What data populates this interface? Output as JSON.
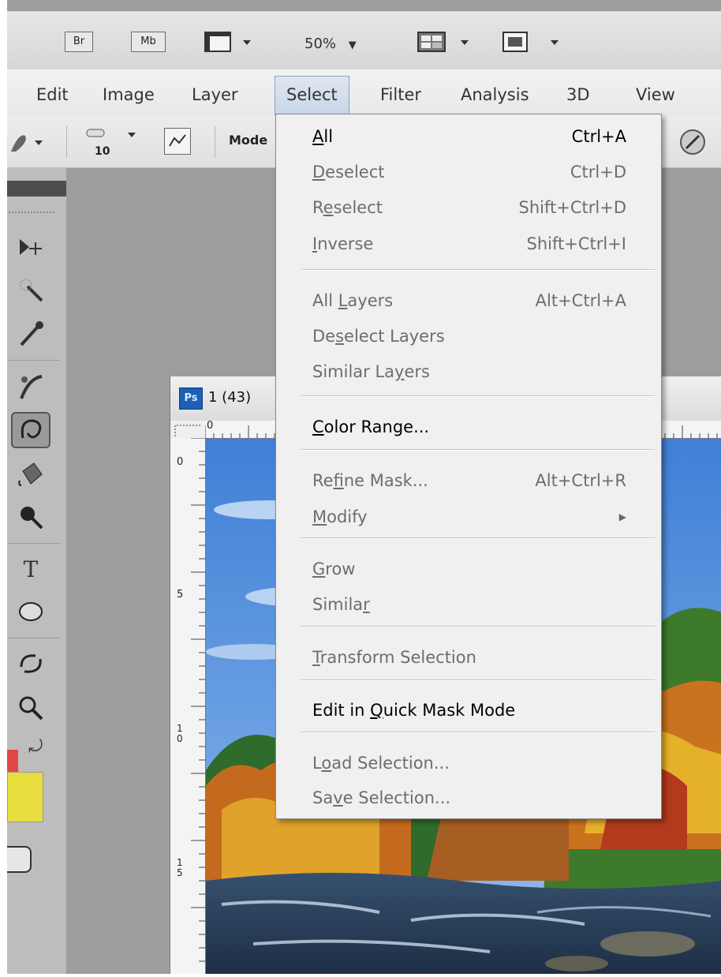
{
  "appbar": {
    "bridge_label": "Br",
    "minibridge_label": "Mb",
    "zoom_value": "50%",
    "dropdown_arrow": "▼"
  },
  "menubar": {
    "items": [
      "Edit",
      "Image",
      "Layer",
      "Select",
      "Filter",
      "Analysis",
      "3D",
      "View"
    ],
    "active": "Select"
  },
  "options": {
    "brush_size": "10",
    "mode_label": "Mode"
  },
  "document": {
    "tab_icon": "Ps",
    "title": "1 (43)",
    "ruler_top_zero": "0",
    "ruler_left_labels": [
      "0",
      "5",
      "1\n0",
      "1\n5"
    ]
  },
  "select_menu": {
    "items": [
      {
        "label": "All",
        "mnemonic": "A",
        "shortcut": "Ctrl+A",
        "enabled": true
      },
      {
        "label": "Deselect",
        "mnemonic": "D",
        "shortcut": "Ctrl+D",
        "enabled": false
      },
      {
        "label": "Reselect",
        "mnemonic": "e",
        "shortcut": "Shift+Ctrl+D",
        "enabled": false
      },
      {
        "label": "Inverse",
        "mnemonic": "I",
        "shortcut": "Shift+Ctrl+I",
        "enabled": false
      },
      {
        "label": "All Layers",
        "mnemonic": "L",
        "shortcut": "Alt+Ctrl+A",
        "enabled": false
      },
      {
        "label": "Deselect Layers",
        "mnemonic": "s",
        "shortcut": "",
        "enabled": false
      },
      {
        "label": "Similar Layers",
        "mnemonic": "y",
        "shortcut": "",
        "enabled": false
      },
      {
        "label": "Color Range...",
        "mnemonic": "C",
        "shortcut": "",
        "enabled": true
      },
      {
        "label": "Refine Mask...",
        "mnemonic": "f",
        "shortcut": "Alt+Ctrl+R",
        "enabled": false
      },
      {
        "label": "Modify",
        "mnemonic": "M",
        "shortcut": "",
        "enabled": false,
        "submenu": true
      },
      {
        "label": "Grow",
        "mnemonic": "G",
        "shortcut": "",
        "enabled": false
      },
      {
        "label": "Similar",
        "mnemonic": "r",
        "shortcut": "",
        "enabled": false
      },
      {
        "label": "Transform Selection",
        "mnemonic": "T",
        "shortcut": "",
        "enabled": false
      },
      {
        "label": "Edit in Quick Mask Mode",
        "mnemonic": "Q",
        "shortcut": "",
        "enabled": true
      },
      {
        "label": "Load Selection...",
        "mnemonic": "o",
        "shortcut": "",
        "enabled": false
      },
      {
        "label": "Save Selection...",
        "mnemonic": "v",
        "shortcut": "",
        "enabled": false
      }
    ]
  },
  "colors": {
    "foreground": "#e04848",
    "background": "#e8dd3e",
    "menu_highlight": "#c8d6e8"
  }
}
